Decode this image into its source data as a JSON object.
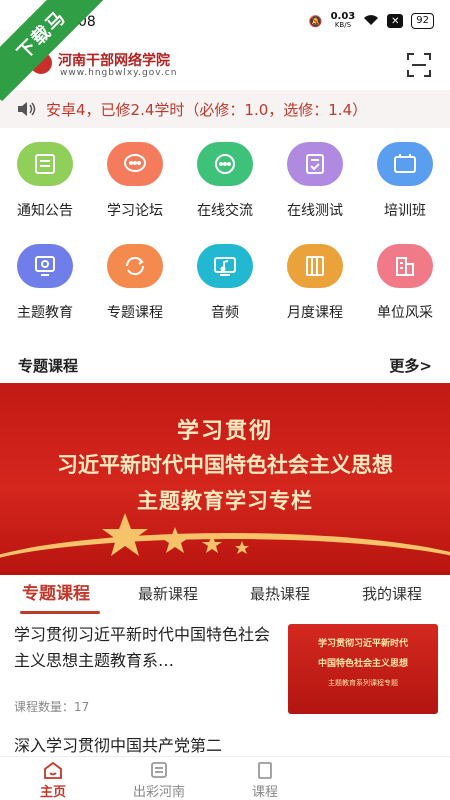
{
  "status_bar": {
    "time": "08",
    "net_speed": "0.03",
    "net_unit": "KB/S",
    "battery": "92"
  },
  "ribbon": {
    "label": "下载马"
  },
  "header": {
    "title": "河南干部网络学院",
    "url": "www.hngbwlxy.gov.cn"
  },
  "notice": {
    "text": "安卓4，已修2.4学时（必修：1.0，选修：1.4）"
  },
  "grid": {
    "row1": [
      {
        "label": "通知公告",
        "icon": "notice-icon",
        "color": "#8fcf5a"
      },
      {
        "label": "学习论坛",
        "icon": "chat-bubble-icon",
        "color": "#f47b5c"
      },
      {
        "label": "在线交流",
        "icon": "message-icon",
        "color": "#3ec27a"
      },
      {
        "label": "在线测试",
        "icon": "test-icon",
        "color": "#b08ae0"
      },
      {
        "label": "培训班",
        "icon": "class-icon",
        "color": "#5a9ef0"
      }
    ],
    "row2": [
      {
        "label": "主题教育",
        "icon": "screen-icon",
        "color": "#6f7ee8"
      },
      {
        "label": "专题课程",
        "icon": "refresh-icon",
        "color": "#f58a4e"
      },
      {
        "label": "音频",
        "icon": "music-icon",
        "color": "#22b8d2"
      },
      {
        "label": "月度课程",
        "icon": "book-icon",
        "color": "#eba23a"
      },
      {
        "label": "单位风采",
        "icon": "building-icon",
        "color": "#f07a88"
      }
    ]
  },
  "section": {
    "title": "专题课程",
    "more": "更多>"
  },
  "banner": {
    "line1": "学习贯彻",
    "line2": "习近平新时代中国特色社会主义思想",
    "line3": "主题教育学习专栏"
  },
  "tabs": [
    "专题课程",
    "最新课程",
    "最热课程",
    "我的课程"
  ],
  "courses": [
    {
      "title": "学习贯彻习近平新时代中国特色社会主义思想主题教育系…",
      "count_label": "课程数量：17",
      "thumb_line1": "学习贯彻习近平新时代",
      "thumb_line2": "中国特色社会主义思想",
      "thumb_line3": "主题教育系列课程专题"
    },
    {
      "title": "深入学习贯彻中国共产党第二"
    }
  ],
  "bottom_nav": [
    {
      "label": "主页",
      "icon": "home-icon"
    },
    {
      "label": "出彩河南",
      "icon": "flag-icon"
    },
    {
      "label": "课程",
      "icon": "course-icon"
    }
  ],
  "colors": {
    "accent": "#c0392b"
  }
}
